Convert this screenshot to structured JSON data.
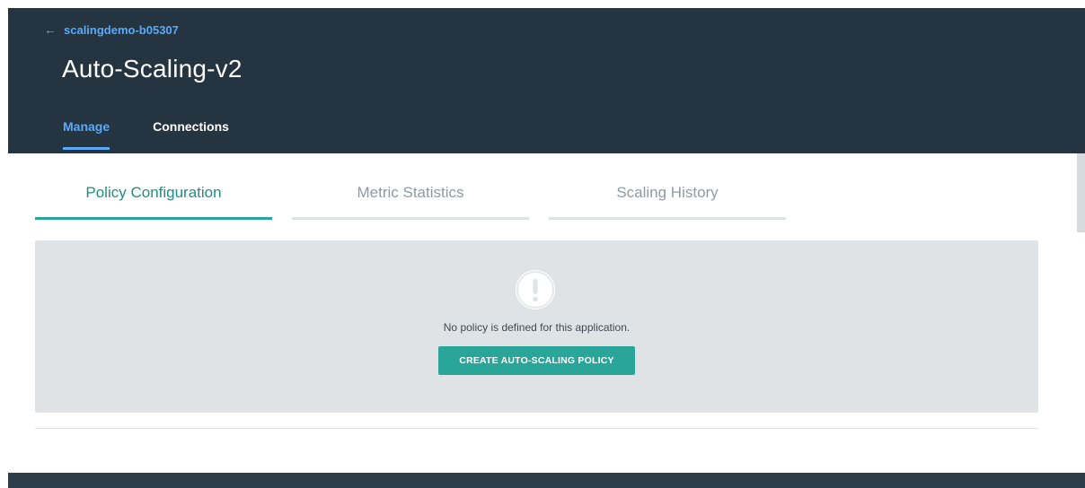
{
  "header": {
    "back_arrow": "←",
    "back_label": "scalingdemo-b05307",
    "title": "Auto-Scaling-v2",
    "tabs": [
      {
        "label": "Manage",
        "active": true
      },
      {
        "label": "Connections",
        "active": false
      }
    ]
  },
  "content": {
    "tabs": [
      {
        "label": "Policy Configuration",
        "active": true
      },
      {
        "label": "Metric Statistics",
        "active": false
      },
      {
        "label": "Scaling History",
        "active": false
      }
    ],
    "empty_state": {
      "icon": "exclamation-icon",
      "message": "No policy is defined for this application.",
      "button_label": "CREATE AUTO-SCALING POLICY"
    }
  },
  "colors": {
    "header_bg": "#243441",
    "link_blue": "#5aaafa",
    "accent_teal": "#2aa59a",
    "panel_bg": "#dfe3e6"
  }
}
